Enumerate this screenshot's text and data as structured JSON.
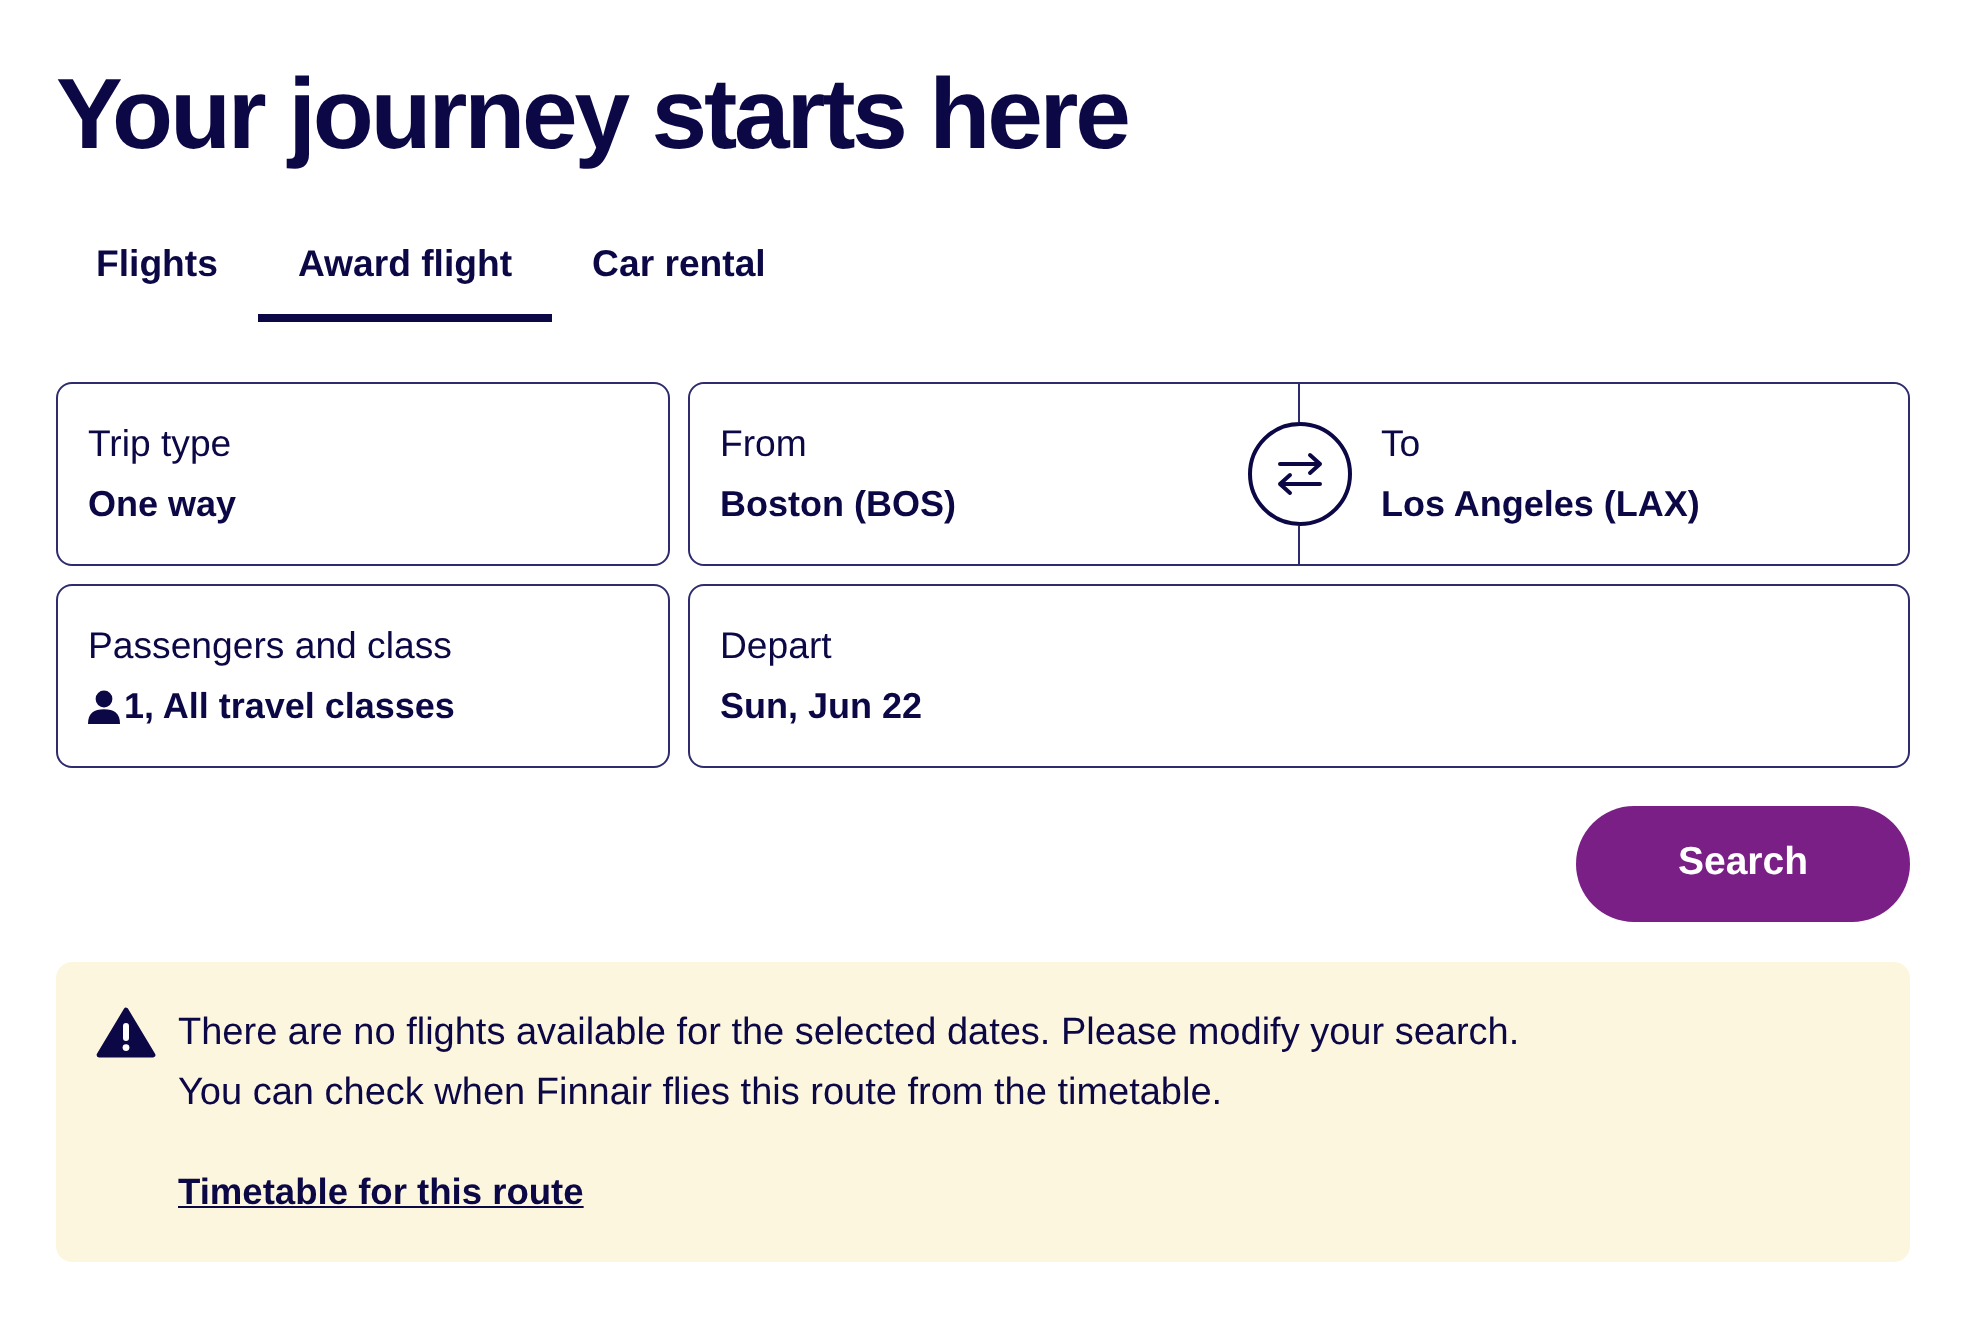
{
  "heading": "Your journey starts here",
  "tabs": [
    {
      "label": "Flights",
      "selected": false
    },
    {
      "label": "Award flight",
      "selected": true
    },
    {
      "label": "Car rental",
      "selected": false
    }
  ],
  "trip_type": {
    "label": "Trip type",
    "value": "One way"
  },
  "route": {
    "from": {
      "label": "From",
      "value": "Boston (BOS)"
    },
    "to": {
      "label": "To",
      "value": "Los Angeles (LAX)"
    }
  },
  "passengers": {
    "label": "Passengers and class",
    "value": "1, All travel classes"
  },
  "depart": {
    "label": "Depart",
    "value": "Sun, Jun 22"
  },
  "search_button": {
    "label": "Search"
  },
  "notice": {
    "lines": [
      "There are no flights available for the selected dates. Please modify your search.",
      "You can check when Finnair flies this route from the timetable."
    ],
    "link": "Timetable for this route"
  }
}
